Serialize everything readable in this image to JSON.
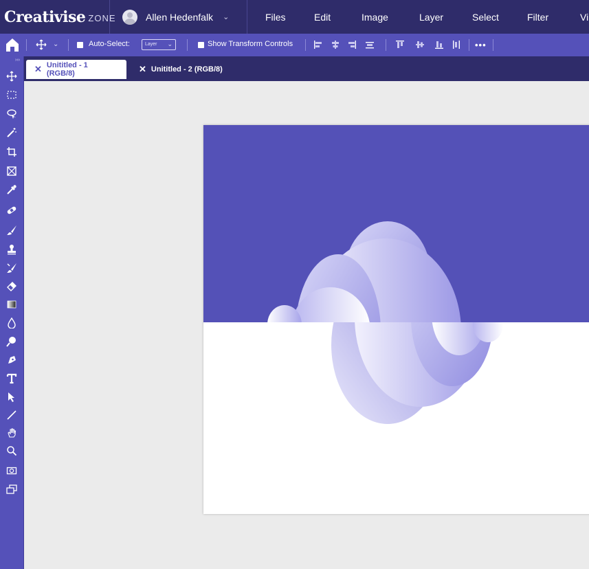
{
  "app": {
    "brand_main": "Creativise",
    "brand_sub": "ZONE",
    "user_name": "Allen Hedenfalk"
  },
  "menu": {
    "items": [
      "Files",
      "Edit",
      "Image",
      "Layer",
      "Select",
      "Filter",
      "Vi"
    ]
  },
  "options": {
    "auto_select_label": "Auto-Select:",
    "auto_select_value": "Layer",
    "transform_label": "Show Transform Controls"
  },
  "tabs": [
    {
      "label": "Unititled - 1 (RGB/8)",
      "active": true
    },
    {
      "label": "Unititled - 2 (RGB/8)",
      "active": false
    }
  ],
  "colors": {
    "menubar": "#2f2c6a",
    "toolbar": "#5551b9",
    "canvas_top": "#5451b7",
    "canvas_bottom": "#ffffff",
    "workspace": "#ebebeb"
  },
  "tools": [
    "move-tool-icon",
    "marquee-tool-icon",
    "lasso-tool-icon",
    "magic-wand-icon",
    "crop-tool-icon",
    "frame-tool-icon",
    "eyedropper-icon",
    "healing-brush-icon",
    "brush-tool-icon",
    "clone-stamp-icon",
    "history-brush-icon",
    "eraser-icon",
    "gradient-tool-icon",
    "blur-tool-icon",
    "dodge-tool-icon",
    "pen-tool-icon",
    "type-tool-icon",
    "path-selection-icon",
    "line-tool-icon",
    "hand-tool-icon",
    "zoom-tool-icon",
    "quick-mask-icon",
    "screen-mode-icon"
  ]
}
